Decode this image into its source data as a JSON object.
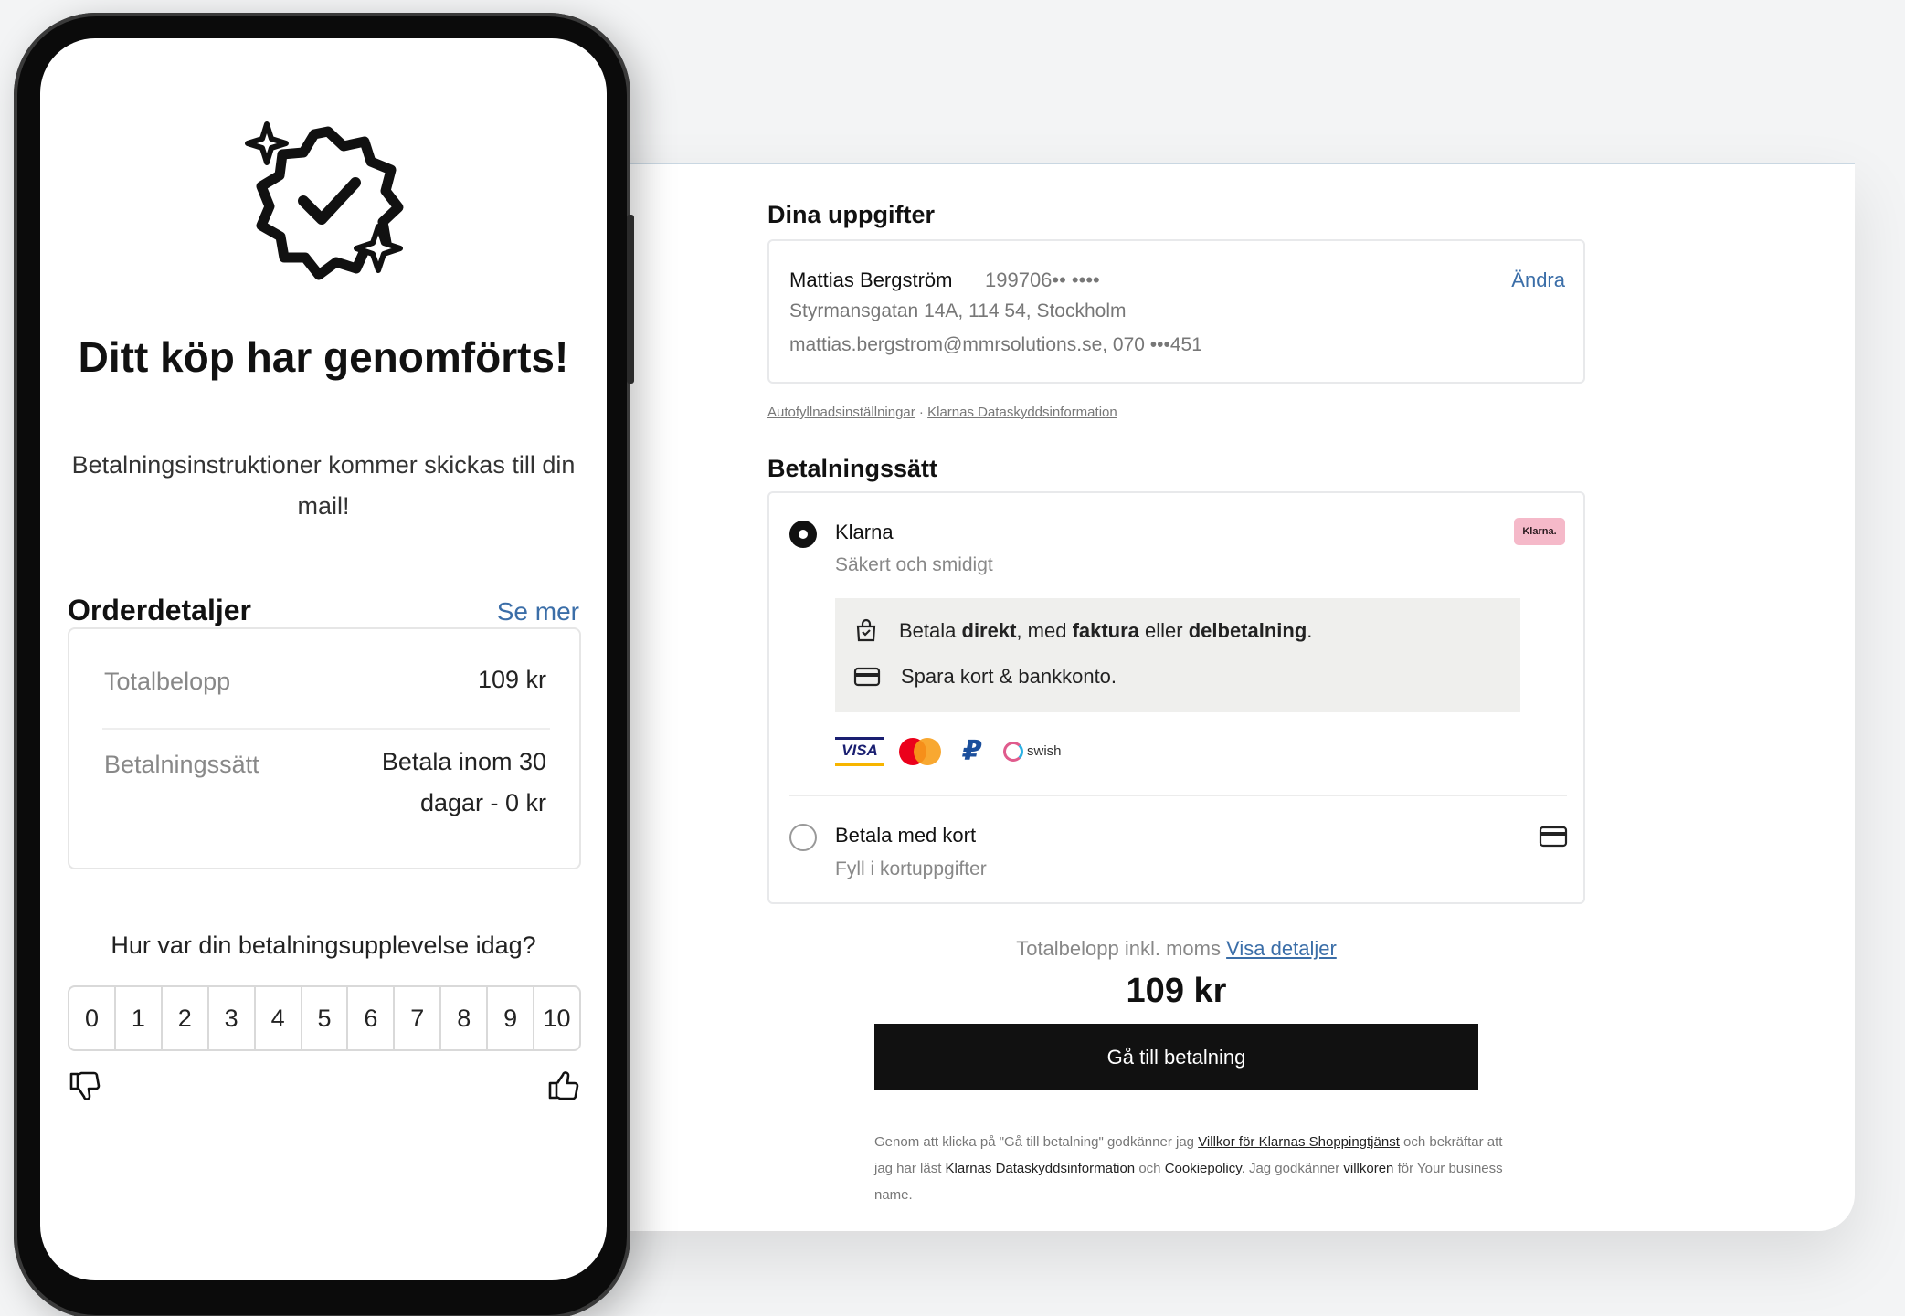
{
  "checkout": {
    "details_title": "Dina uppgifter",
    "customer": {
      "name": "Mattias Bergström",
      "personal_number": "199706•• ••••",
      "address": "Styrmansgatan 14A, 114 54, Stockholm",
      "contact": "mattias.bergstrom@mmrsolutions.se, 070 •••451",
      "change_label": "Ändra"
    },
    "small_links": {
      "autofill": "Autofyllnadsinställningar",
      "separator": " · ",
      "privacy": "Klarnas Dataskyddsinformation"
    },
    "payment_title": "Betalningssätt",
    "klarna": {
      "title": "Klarna",
      "subtitle": "Säkert och smidigt",
      "logo_text": "Klarna.",
      "logo_color": "#f5b9c9",
      "feature1": {
        "p1": "Betala ",
        "b1": "direkt",
        "p2": ", med ",
        "b2": "faktura",
        "p3": " eller ",
        "b3": "delbetalning",
        "p4": "."
      },
      "feature2": "Spara kort & bankkonto.",
      "logos": {
        "visa": "VISA",
        "swish": "swish"
      }
    },
    "card": {
      "title": "Betala med kort",
      "subtitle": "Fyll i kortuppgifter"
    },
    "total_label": "Totalbelopp inkl. moms",
    "total_link": "Visa detaljer",
    "total_amount": "109 kr",
    "cta": "Gå till betalning",
    "legal": {
      "t1": "Genom att klicka på \"Gå till betalning\" godkänner jag ",
      "l1": "Villkor för Klarnas Shoppingtjänst",
      "t2": " och bekräftar att jag har läst ",
      "l2": "Klarnas Dataskyddsinformation",
      "t3": " och ",
      "l3": "Cookiepolicy",
      "t4": ". Jag godkänner ",
      "l4": "villkoren",
      "t5": " för Your business name."
    }
  },
  "phone": {
    "title": "Ditt köp har genomförts!",
    "subtitle": "Betalningsinstruktioner kommer skickas till din mail!",
    "order_title": "Orderdetaljer",
    "see_more": "Se mer",
    "total_label": "Totalbelopp",
    "total_value": "109 kr",
    "method_label": "Betalningssätt",
    "method_value_1": "Betala inom 30",
    "method_value_2": "dagar - 0 kr",
    "question": "Hur var din betalningsupplevelse idag?",
    "scale": [
      "0",
      "1",
      "2",
      "3",
      "4",
      "5",
      "6",
      "7",
      "8",
      "9",
      "10"
    ]
  },
  "colors": {
    "link": "#3b6ea8",
    "cta": "#111111"
  }
}
